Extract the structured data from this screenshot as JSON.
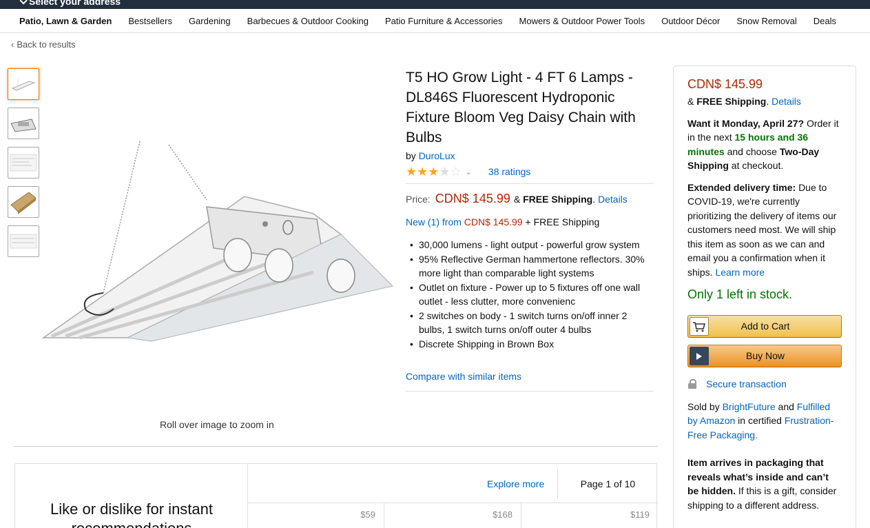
{
  "top_bar": {
    "address_label": "Select your address"
  },
  "category_nav": [
    "Patio, Lawn & Garden",
    "Bestsellers",
    "Gardening",
    "Barbecues & Outdoor Cooking",
    "Patio Furniture & Accessories",
    "Mowers & Outdoor Power Tools",
    "Outdoor Décor",
    "Snow Removal",
    "Deals"
  ],
  "back_link": "Back to results",
  "gallery": {
    "thumbnails": [
      "thumb-1",
      "thumb-2",
      "thumb-3",
      "thumb-4",
      "thumb-5"
    ],
    "zoom_hint": "Roll over image to zoom in"
  },
  "product": {
    "title": "T5 HO Grow Light - 4 FT 6 Lamps - DL846S Fluorescent Hydroponic Fixture Bloom Veg Daisy Chain with Bulbs",
    "by_label": "by",
    "brand": "DuroLux",
    "rating": 3.5,
    "ratings_count": "38 ratings",
    "price_label": "Price:",
    "price": "CDN$ 145.99",
    "free_shipping_prefix": "&",
    "free_shipping": "FREE Shipping",
    "details_link": "Details",
    "new_from_link": "New (1) from",
    "new_from_price": "CDN$ 145.99",
    "new_from_suffix": "+ FREE Shipping",
    "bullets": [
      "30,000 lumens - light output - powerful grow system",
      "95% Reflective German hammertone reflectors. 30% more light than comparable light systems",
      "Outlet on fixture - Power up to 5 fixtures off one wall outlet - less clutter, more convenienc",
      "2 switches on body - 1 switch turns on/off inner 2 bulbs, 1 switch turns on/off outer 4 bulbs",
      "Discrete Shipping in Brown Box"
    ],
    "compare_link": "Compare with similar items"
  },
  "buy_box": {
    "price": "CDN$ 145.99",
    "ship_prefix": "&",
    "free_shipping": "FREE Shipping",
    "details_link": "Details",
    "want_it": "Want it Monday, April 27?",
    "order_within_prefix": "Order it in the next",
    "order_within_time": "15 hours and 36 minutes",
    "choose_prefix": "and choose",
    "two_day": "Two-Day Shipping",
    "at_checkout": "at checkout.",
    "extended_label": "Extended delivery time:",
    "extended_text": "Due to COVID-19, we're currently prioritizing the delivery of items our customers need most. We will ship this item as soon as we can and email you a confirmation when it ships.",
    "learn_more": "Learn more",
    "stock": "Only 1 left in stock.",
    "add_to_cart": "Add to Cart",
    "buy_now": "Buy Now",
    "secure": "Secure transaction",
    "sold_by_prefix": "Sold by",
    "seller": "BrightFuture",
    "and": "and",
    "fulfilled": "Fulfilled by Amazon",
    "in_certified": "in certified",
    "frustration_free": "Frustration-Free Packaging.",
    "packaging_bold": "Item arrives in packaging that reveals what’s inside and can’t be hidden.",
    "packaging_text": "If this is a gift, consider shipping to a different address."
  },
  "recommendations": {
    "prompt": "Like or dislike for instant recommendations",
    "explore_more": "Explore more",
    "page_indicator": "Page 1 of 10",
    "card_prices": [
      "$59",
      "$168",
      "$119"
    ]
  },
  "colors": {
    "price_red": "#b12704",
    "link_blue": "#0066c0",
    "stock_green": "#007600",
    "nav_dark": "#232f3e"
  }
}
